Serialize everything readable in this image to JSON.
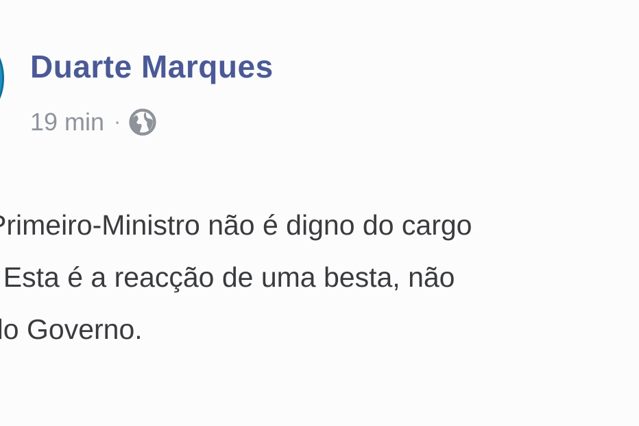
{
  "post": {
    "author": "Duarte Marques",
    "timestamp": "19 min",
    "separator": "·",
    "privacy_icon": "globe-icon",
    "lines": [
      "Primeiro-Ministro não é digno do cargo",
      ". Esta é a reacção de uma besta, não",
      "do Governo."
    ]
  },
  "colors": {
    "author": "#4b5a96",
    "meta": "#8e939b",
    "body": "#3a3b3e",
    "avatar": "#1f8fbf"
  }
}
